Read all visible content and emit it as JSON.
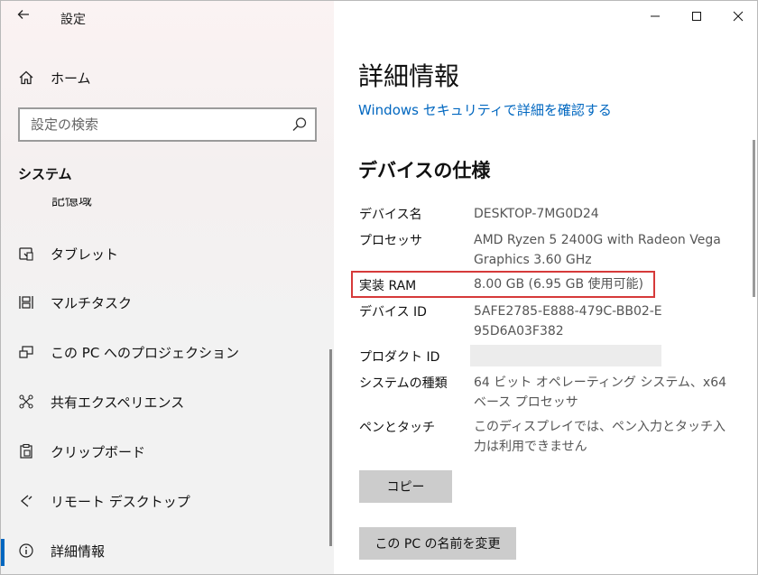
{
  "app": {
    "title": "設定"
  },
  "sidebar": {
    "home_label": "ホーム",
    "search_placeholder": "設定の検索",
    "section_title": "システム",
    "clipped_item_label": "記憶域",
    "items": [
      {
        "label": "タブレット",
        "icon": "tablet-icon"
      },
      {
        "label": "マルチタスク",
        "icon": "multitask-icon"
      },
      {
        "label": "この PC へのプロジェクション",
        "icon": "projection-icon"
      },
      {
        "label": "共有エクスペリエンス",
        "icon": "shared-experience-icon"
      },
      {
        "label": "クリップボード",
        "icon": "clipboard-icon"
      },
      {
        "label": "リモート デスクトップ",
        "icon": "remote-desktop-icon"
      },
      {
        "label": "詳細情報",
        "icon": "info-icon",
        "active": true
      }
    ]
  },
  "content": {
    "page_title": "詳細情報",
    "security_link": "Windows セキュリティで詳細を確認する",
    "spec_heading": "デバイスの仕様",
    "specs": [
      {
        "label": "デバイス名",
        "value": "DESKTOP-7MG0D24"
      },
      {
        "label": "プロセッサ",
        "value": "AMD Ryzen 5 2400G with Radeon Vega Graphics      3.60 GHz"
      },
      {
        "label": "実装 RAM",
        "value": "8.00 GB (6.95 GB 使用可能)"
      },
      {
        "label": "デバイス ID",
        "value": "5AFE2785-E888-479C-BB02-E95D6A03F382"
      },
      {
        "label": "プロダクト ID",
        "value": ""
      },
      {
        "label": "システムの種類",
        "value": "64 ビット オペレーティング システム、x64 ベース プロセッサ"
      },
      {
        "label": "ペンとタッチ",
        "value": "このディスプレイでは、ペン入力とタッチ入力は利用できません"
      }
    ],
    "copy_button": "コピー",
    "rename_button": "この PC の名前を変更"
  },
  "colors": {
    "accent": "#0067c0",
    "highlight_box": "#d63a3a",
    "button_bg": "#cccccc"
  }
}
